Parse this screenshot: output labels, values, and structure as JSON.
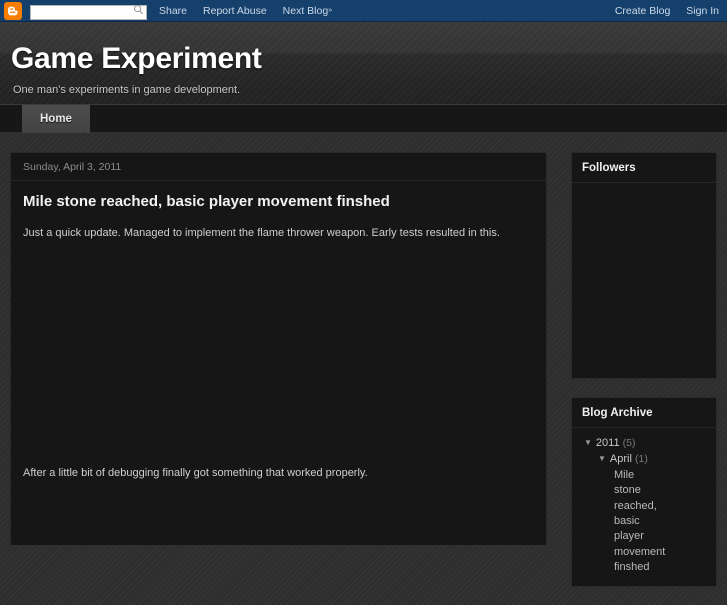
{
  "navbar": {
    "logo_icon": "blogger-b-icon",
    "search": {
      "value": "",
      "placeholder": "",
      "icon": "search-icon"
    },
    "links": [
      {
        "label": "Share"
      },
      {
        "label": "Report Abuse"
      },
      {
        "label": "Next Blog",
        "suffix": "»"
      }
    ],
    "right_links": [
      {
        "label": "Create Blog"
      },
      {
        "label": "Sign In"
      }
    ],
    "background_color": "#16406c",
    "logo_color": "#f57d00"
  },
  "header": {
    "title": "Game Experiment",
    "description": "One man's experiments in game development."
  },
  "tabs": [
    {
      "label": "Home",
      "selected": true
    }
  ],
  "main": {
    "post": {
      "date_header": "Sunday, April 3, 2011",
      "title": "Mile stone reached, basic player movement finshed",
      "paragraph_1": "Just a quick update. Managed to implement the flame thrower weapon. Early tests resulted in this.",
      "paragraph_2": "After a little bit of debugging finally got something that worked properly."
    }
  },
  "sidebar": {
    "followers": {
      "title": "Followers",
      "content": ""
    },
    "blog_archive": {
      "title": "Blog Archive",
      "items": [
        {
          "arrow": "▼",
          "label": "2011",
          "count": "(5)",
          "level": 1
        },
        {
          "arrow": "▼",
          "label": "April",
          "count": "(1)",
          "level": 2
        },
        {
          "arrow": "",
          "label": "Mile stone reached, basic player movement finshed",
          "count": "",
          "level": 3
        }
      ]
    }
  }
}
